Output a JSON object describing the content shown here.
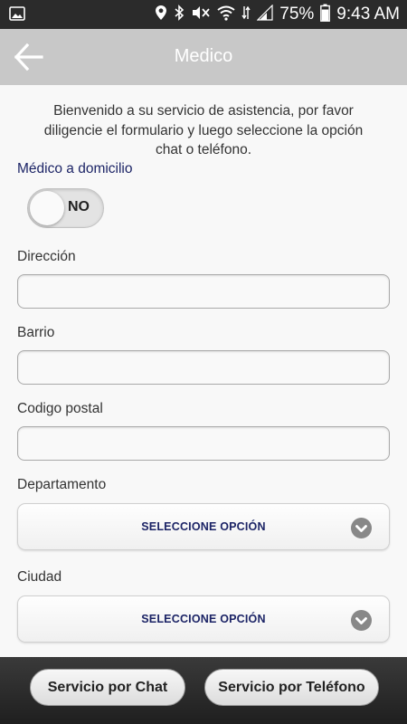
{
  "status_bar": {
    "battery": "75%",
    "time": "9:43 AM",
    "icons": [
      "image-icon",
      "location-icon",
      "bluetooth-icon",
      "mute-icon",
      "wifi-icon",
      "data-icon",
      "signal-icon",
      "battery-icon"
    ]
  },
  "app_bar": {
    "title": "Medico",
    "back_icon": "arrow-left-icon"
  },
  "form": {
    "intro": "Bienvenido a su servicio de asistencia, por favor diligencie el formulario y luego seleccione la opción chat o teléfono.",
    "home_visit": {
      "label": "Médico a domicilio",
      "toggle_value": "NO"
    },
    "address": {
      "label": "Dirección",
      "value": ""
    },
    "neighborhood": {
      "label": "Barrio",
      "value": ""
    },
    "postal_code": {
      "label": "Codigo postal",
      "value": ""
    },
    "department": {
      "label": "Departamento",
      "selected": "SELECCIONE OPCIÓN"
    },
    "city": {
      "label": "Ciudad",
      "selected": "SELECCIONE OPCIÓN"
    }
  },
  "actions": {
    "chat": "Servicio por Chat",
    "phone": "Servicio por Teléfono"
  },
  "colors": {
    "status_bar": "#2b2b2b",
    "app_bar": "#c8c8c8",
    "label_accent": "#1c2466",
    "bottom_bar": "#2a2a2a"
  }
}
